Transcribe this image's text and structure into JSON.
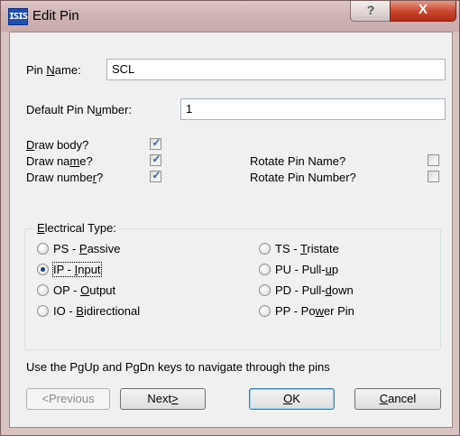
{
  "window": {
    "title": "Edit Pin",
    "icon_text": "ISIS",
    "help_label": "?",
    "close_label": "X"
  },
  "fields": {
    "pin_name": {
      "label_pre": "Pin ",
      "label_u": "N",
      "label_post": "ame:",
      "value": "SCL"
    },
    "default_pin_number": {
      "label_pre": "Default Pin N",
      "label_u": "u",
      "label_post": "mber:",
      "value": "1"
    }
  },
  "checkboxes": {
    "draw_body": {
      "u": "D",
      "rest": "raw body?",
      "checked": true
    },
    "draw_name": {
      "pre": "Draw na",
      "u": "m",
      "post": "e?",
      "checked": true
    },
    "draw_number": {
      "pre": "Draw numbe",
      "u": "r",
      "post": "?",
      "checked": true
    },
    "rotate_pin_name": {
      "text": "Rotate Pin Name?",
      "checked": false
    },
    "rotate_pin_number": {
      "text": "Rotate Pin Number?",
      "checked": false
    }
  },
  "electrical_type": {
    "title_u": "E",
    "title_rest": "lectrical Type:",
    "options": {
      "ps": {
        "pre": "PS - ",
        "u": "P",
        "post": "assive",
        "selected": false
      },
      "ip": {
        "pre": "IP - ",
        "u": "I",
        "post": "nput",
        "selected": true
      },
      "op": {
        "pre": "OP - ",
        "u": "O",
        "post": "utput",
        "selected": false
      },
      "io": {
        "pre": "IO - ",
        "u": "B",
        "post": "idirectional",
        "selected": false
      },
      "ts": {
        "pre": "TS - ",
        "u": "T",
        "post": "ristate",
        "selected": false
      },
      "pu": {
        "pre": "PU - Pull-",
        "u": "u",
        "post": "p",
        "selected": false
      },
      "pd": {
        "pre": "PD - Pull-",
        "u": "d",
        "post": "own",
        "selected": false
      },
      "pp": {
        "pre": "PP - Po",
        "u": "w",
        "post": "er Pin",
        "selected": false
      }
    }
  },
  "hint": "Use the PgUp and PgDn keys to navigate through the pins",
  "buttons": {
    "previous": "<Previous",
    "next": {
      "pre": "Next",
      "u": ">"
    },
    "ok": {
      "u": "O",
      "post": "K"
    },
    "cancel": {
      "u": "C",
      "post": "ancel"
    }
  },
  "colors": {
    "accent": "#1a3c8a",
    "close": "#c8432b"
  }
}
